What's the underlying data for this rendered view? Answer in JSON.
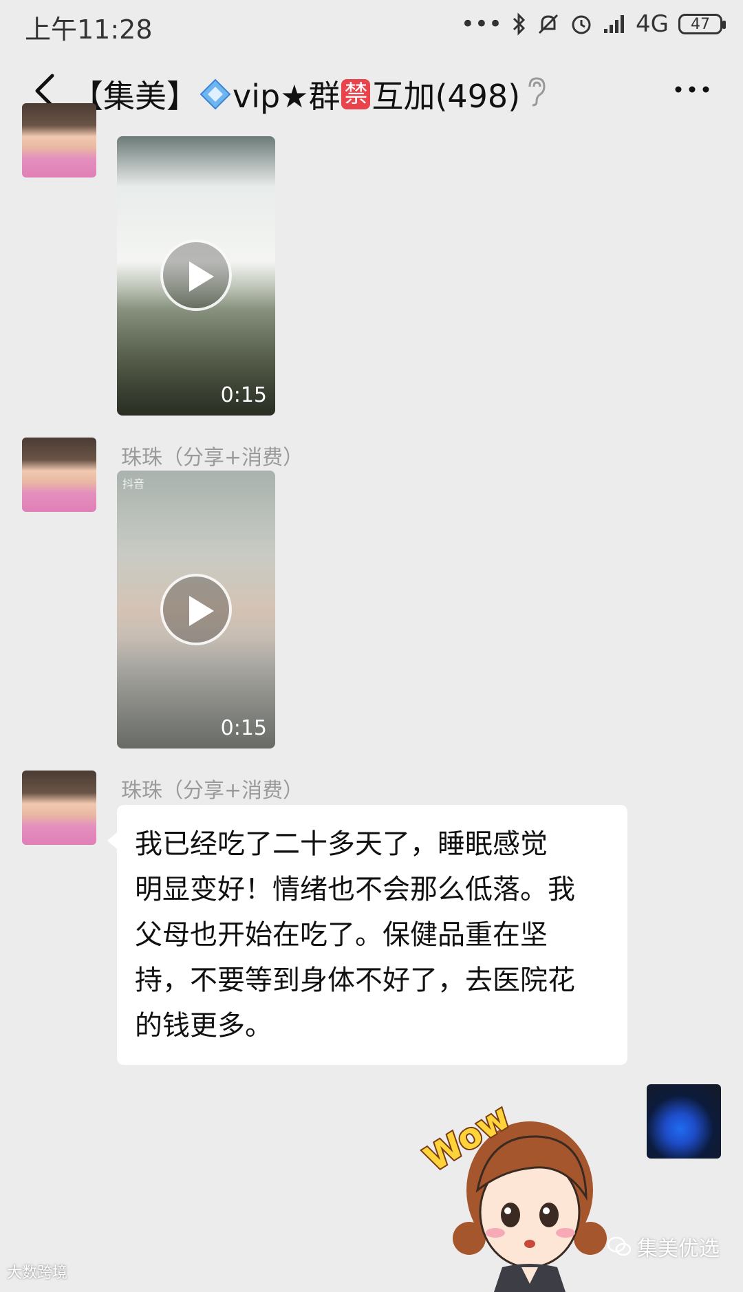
{
  "status_bar": {
    "time": "上午11:28",
    "network": "4G",
    "battery": "47"
  },
  "header": {
    "title_prefix": "【集美】",
    "title_vip": "vip★群",
    "title_ban": "禁",
    "title_suffix": "互加(498)"
  },
  "messages": [
    {
      "type": "video",
      "duration": "0:15"
    },
    {
      "type": "video",
      "sender": "珠珠（分享+消费）",
      "tiktok_label": "抖音",
      "duration": "0:15"
    },
    {
      "type": "text",
      "sender": "珠珠（分享+消费）",
      "lines": [
        "我已经吃了二十多天了，睡眠感觉",
        "明显变好！情绪也不会那么低落。我",
        "父母也开始在吃了。保健品重在坚",
        "持，不要等到身体不好了，去医院花",
        "的钱更多。"
      ]
    },
    {
      "type": "sticker",
      "text": "Wow"
    }
  ],
  "watermarks": {
    "left": "大数跨境",
    "right": "集美优选"
  },
  "colors": {
    "background": "#ececec",
    "bubble": "#ffffff",
    "ban_badge": "#e9434b"
  }
}
